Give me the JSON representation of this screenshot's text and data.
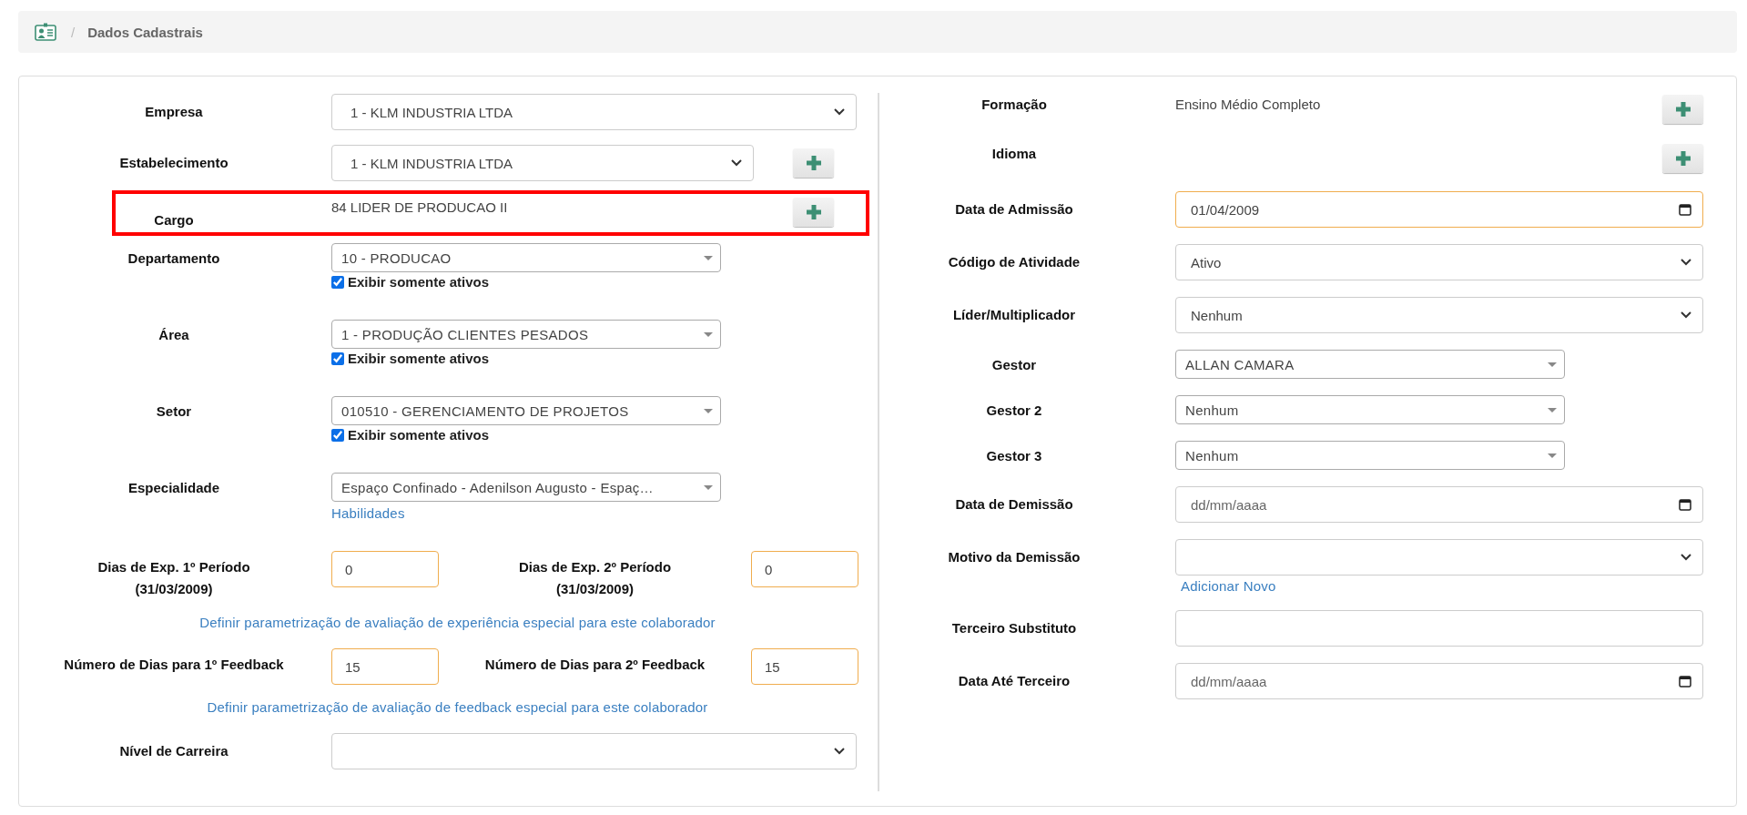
{
  "breadcrumb": {
    "separator": "/",
    "title": "Dados Cadastrais"
  },
  "left": [
    {
      "kind": "select",
      "label": "Empresa",
      "value": "1 - KLM INDUSTRIA LTDA",
      "add_button": false,
      "highlighted": false
    },
    {
      "kind": "select",
      "label": "Estabelecimento",
      "value": "1 - KLM INDUSTRIA LTDA",
      "add_button": true,
      "highlighted": false
    },
    {
      "kind": "text",
      "label": "Cargo",
      "value": "84 LIDER DE PRODUCAO II",
      "add_button": true,
      "highlighted": true
    },
    {
      "kind": "combo",
      "label": "Departamento",
      "value": "10 - PRODUCAO",
      "option": {
        "label": "Exibir somente ativos",
        "checked": true
      }
    },
    {
      "kind": "combo",
      "label": "Área",
      "value": "1 - PRODUÇÃO CLIENTES PESADOS",
      "option": {
        "label": "Exibir somente ativos",
        "checked": true
      }
    },
    {
      "kind": "combo",
      "label": "Setor",
      "value": "010510 - GERENCIAMENTO DE PROJETOS",
      "option": {
        "label": "Exibir somente ativos",
        "checked": true
      }
    },
    {
      "kind": "combo",
      "label": "Especialidade",
      "value": "Espaço Confinado - Adenilson Augusto - Espaç…",
      "link": "Habilidades"
    },
    {
      "kind": "pair",
      "fields": [
        {
          "label": "Dias de Exp. 1º Período",
          "note": "(31/03/2009)",
          "value": "0",
          "required": true
        },
        {
          "label": "Dias de Exp. 2º Período",
          "note": "(31/03/2009)",
          "value": "0",
          "required": true
        }
      ]
    },
    {
      "kind": "link",
      "text": "Definir parametrização de avaliação de experiência especial para este colaborador"
    },
    {
      "kind": "pair",
      "fields": [
        {
          "label": "Número de Dias para 1º Feedback",
          "value": "15",
          "required": true
        },
        {
          "label": "Número de Dias para 2º Feedback",
          "value": "15",
          "required": true
        }
      ]
    },
    {
      "kind": "link",
      "text": "Definir parametrização de avaliação de feedback especial para este colaborador"
    },
    {
      "kind": "select",
      "label": "Nível de Carreira",
      "add_button": false,
      "highlighted": false
    }
  ],
  "right": [
    {
      "kind": "text",
      "label": "Formação",
      "value": "Ensino Médio Completo",
      "add_button": true
    },
    {
      "kind": "text",
      "label": "Idioma",
      "add_button": true
    },
    {
      "kind": "date",
      "label": "Data de Admissão",
      "value": "01/04/2009",
      "required": true
    },
    {
      "kind": "select",
      "label": "Código de Atividade",
      "value": "Ativo"
    },
    {
      "kind": "select",
      "label": "Líder/Multiplicador",
      "value": "Nenhum"
    },
    {
      "kind": "combo",
      "label": "Gestor",
      "value": "ALLAN CAMARA"
    },
    {
      "kind": "combo",
      "label": "Gestor 2",
      "value": "Nenhum"
    },
    {
      "kind": "combo",
      "label": "Gestor 3",
      "value": "Nenhum"
    },
    {
      "kind": "date",
      "label": "Data de Demissão",
      "placeholder": "dd/mm/aaaa",
      "required": false
    },
    {
      "kind": "select",
      "label": "Motivo da Demissão",
      "link": "Adicionar Novo"
    },
    {
      "kind": "input",
      "label": "Terceiro Substituto"
    },
    {
      "kind": "date",
      "label": "Data Até Terceiro",
      "placeholder": "dd/mm/aaaa",
      "required": false
    }
  ]
}
